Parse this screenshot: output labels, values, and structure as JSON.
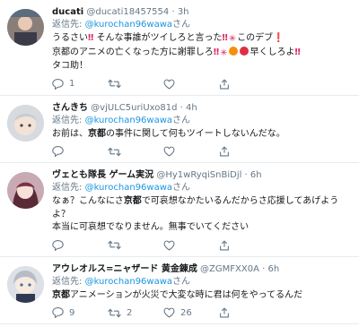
{
  "tweets": [
    {
      "name": "ducati",
      "handle": "@ducati18457554",
      "time": "3h",
      "reply_prefix": "返信先: ",
      "reply_mention": "@kurochan96wawa",
      "reply_suffix": "さん",
      "text_parts": {
        "l1a": "うるさい",
        "l1b": "‼",
        "l1c": " そんな事誰がツイしろと言った",
        "l1d": "‼",
        "l1e": "✳",
        "l1f": "このデブ",
        "l1g": "❗",
        "l2a": "京都のアニメの亡くなった方に謝罪しろ",
        "l2b": "‼",
        "l2c": "✳",
        "l2d": "早くしろよ",
        "l2e": "‼",
        "l3": "タコ助！"
      },
      "replies": "1",
      "retweets": "",
      "likes": "",
      "avatar_desc": "photo"
    },
    {
      "name": "さんきち",
      "handle": "@vjULC5uriUxo81d",
      "time": "4h",
      "reply_prefix": "返信先: ",
      "reply_mention": "@kurochan96wawa",
      "reply_suffix": "さん",
      "text_a": "お前は、",
      "text_b": "京都",
      "text_c": "の事件に関して何もツイートしないんだな。",
      "replies": "",
      "retweets": "",
      "likes": "",
      "avatar_desc": "anime"
    },
    {
      "name": "ヴェとも隊長 ゲーム実況",
      "handle": "@Hy1wRyqiSnBiDjl",
      "time": "6h",
      "reply_prefix": "返信先: ",
      "reply_mention": "@kurochan96wawa",
      "reply_suffix": "さん",
      "text_a": "なぁ？こんなにさ",
      "text_b": "京都",
      "text_c": "で可哀想なかたいるんだからさ応援してあげようよ？\n本当に可哀想でなりません。無事でいてください",
      "replies": "",
      "retweets": "",
      "likes": "",
      "avatar_desc": "anime"
    },
    {
      "name": "アウレオルス=ニャザード 黄金錬成",
      "handle": "@ZGMFXX0A",
      "time": "6h",
      "reply_prefix": "返信先: ",
      "reply_mention": "@kurochan96wawa",
      "reply_suffix": "さん",
      "text_a": "",
      "text_b": "京都",
      "text_c": "アニメーションが火災で大変な時に君は何をやってるんだ",
      "replies": "9",
      "retweets": "2",
      "likes": "26",
      "avatar_desc": "anime"
    }
  ],
  "icons": {
    "reply": "reply-icon",
    "retweet": "retweet-icon",
    "like": "heart-icon",
    "share": "share-icon"
  },
  "colors": {
    "mention": "#1b95e0",
    "secondary": "#657786",
    "divider": "#e6ecf0",
    "alert_red": "#e0245e"
  }
}
